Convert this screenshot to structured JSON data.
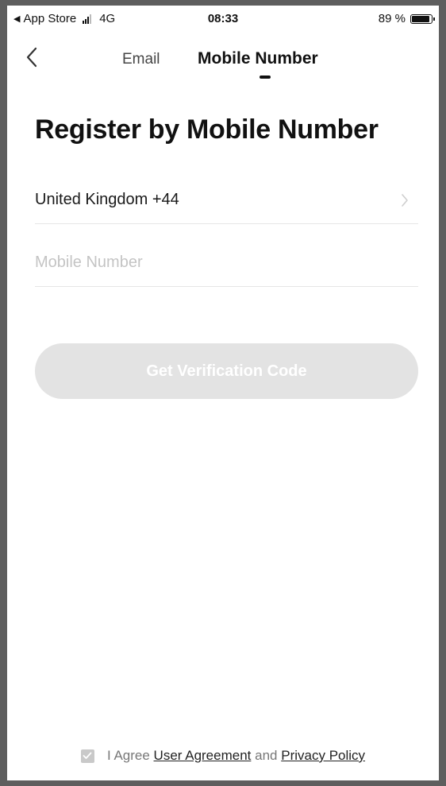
{
  "status_bar": {
    "carrier_back": "App Store",
    "network": "4G",
    "time": "08:33",
    "battery": "89 %"
  },
  "header": {
    "tabs": [
      {
        "label": "Email",
        "active": false
      },
      {
        "label": "Mobile Number",
        "active": true
      }
    ]
  },
  "form": {
    "title": "Register by Mobile Number",
    "country": "United Kingdom +44",
    "mobile_placeholder": "Mobile Number",
    "mobile_value": "",
    "submit_label": "Get Verification Code"
  },
  "agreement": {
    "prefix": "I Agree",
    "user_agreement": "User Agreement",
    "conjunction": "and",
    "privacy_policy": "Privacy Policy",
    "checked": true
  },
  "colors": {
    "button_disabled": "#e3e3e3",
    "text_primary": "#111111",
    "placeholder": "#c4c4c4"
  }
}
